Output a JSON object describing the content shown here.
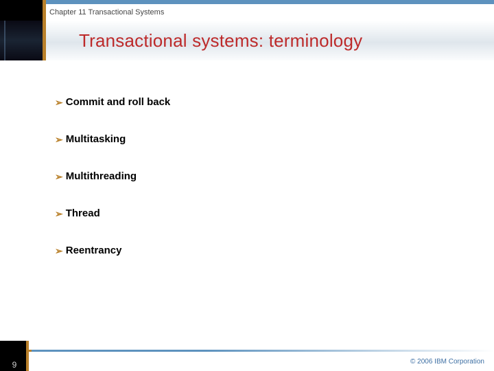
{
  "chapter": "Chapter 11 Transactional Systems",
  "title": "Transactional systems: terminology",
  "bullets": [
    "Commit and roll back",
    "Multitasking",
    "Multithreading",
    "Thread",
    "Reentrancy"
  ],
  "page_number": "9",
  "copyright": "© 2006 IBM Corporation"
}
